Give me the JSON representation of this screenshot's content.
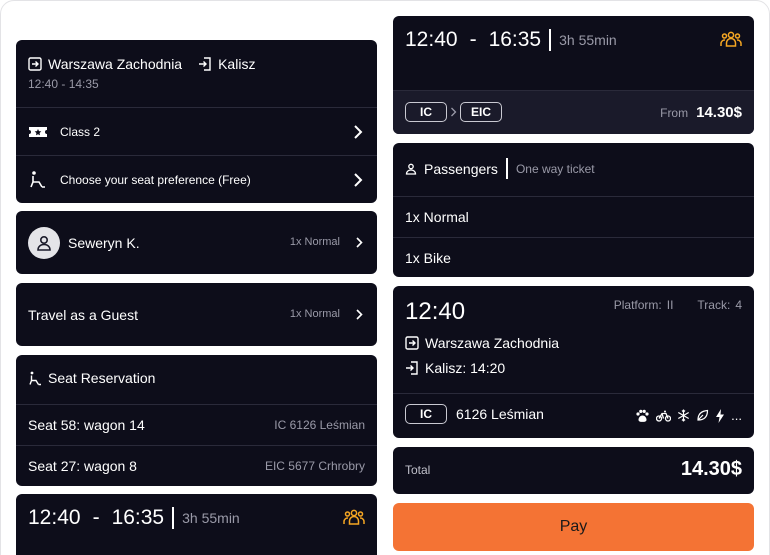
{
  "route": {
    "from": "Warszawa Zachodnia",
    "to": "Kalisz",
    "time": "12:40 - 14:35",
    "class_label": "Class 2",
    "seat_pref_label": "Choose your seat preference (Free)"
  },
  "passenger": {
    "name": "Seweryn K.",
    "type": "1x Normal"
  },
  "guest": {
    "label": "Travel as a Guest",
    "type": "1x Normal"
  },
  "seat_reservation": {
    "title": "Seat Reservation",
    "seats": [
      {
        "seat": "Seat 58: wagon 14",
        "train": "IC 6126 Leśmian"
      },
      {
        "seat": "Seat 27: wagon 8",
        "train": "EIC 5677 Crhrobry"
      }
    ]
  },
  "bottom_left_connection": {
    "dep": "12:40",
    "dash": "-",
    "arr": "16:35",
    "duration": "3h 55min"
  },
  "connection": {
    "dep": "12:40",
    "dash": "-",
    "arr": "16:35",
    "duration": "3h 55min",
    "carrier1": "IC",
    "carrier2": "EIC",
    "from_label": "From",
    "price": "14.30$"
  },
  "passengers": {
    "title": "Passengers",
    "ticket_type": "One way ticket",
    "items": [
      "1x Normal",
      "1x Bike"
    ]
  },
  "departure": {
    "time": "12:40",
    "platform_label": "Platform:",
    "platform": "II",
    "track_label": "Track:",
    "track": "4",
    "station": "Warszawa Zachodnia",
    "arrival": "Kalisz: 14:20",
    "carrier": "IC",
    "train": "6126 Leśmian",
    "more": "..."
  },
  "total": {
    "label": "Total",
    "value": "14.30$"
  },
  "pay_label": "Pay",
  "colors": {
    "card": "#0d0d1a",
    "accent": "#f47334",
    "group_icon": "#f5a623"
  }
}
